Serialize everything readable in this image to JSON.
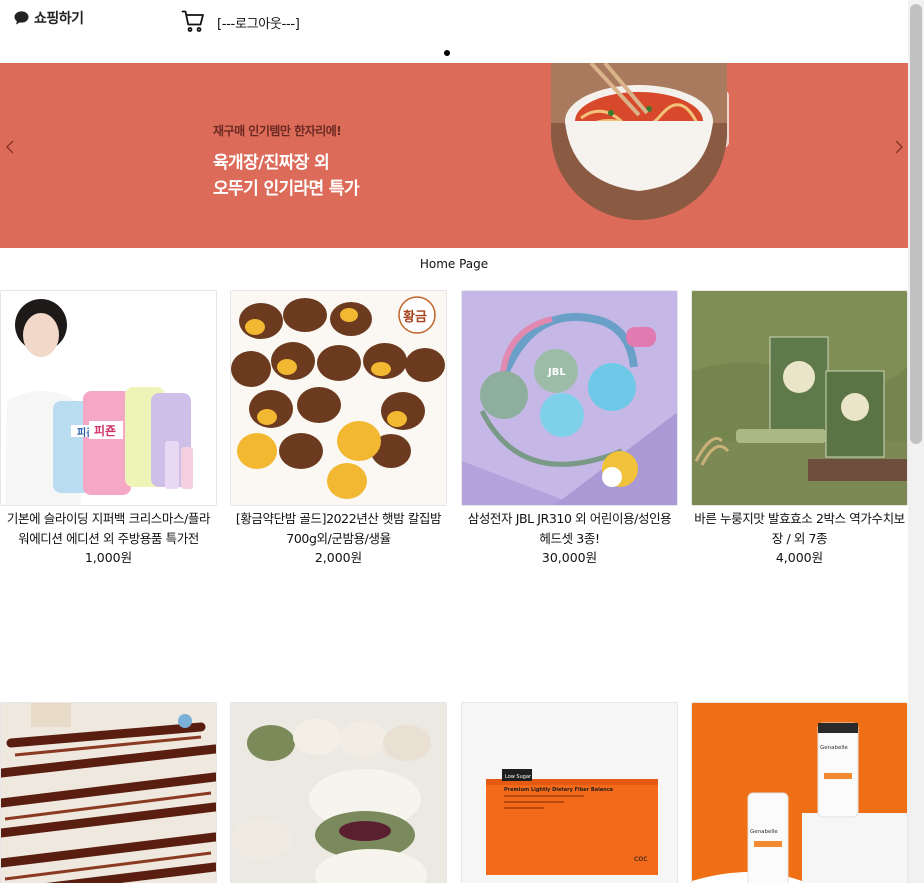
{
  "header": {
    "brand": "쇼핑하기",
    "logout": "[---로그아웃---]"
  },
  "banner": {
    "kicker": "재구매 인기템만 한자리에!",
    "line1": "육개장/진짜장 외",
    "line2": "오뚜기 인기라면 특가",
    "color": "#dd6b5a"
  },
  "home_label": "Home Page",
  "products": [
    {
      "name": "기본에 슬라이딩 지퍼백 크리스마스/플라워에디션 에디션 외 주방용품 특가전",
      "price": "1,000원"
    },
    {
      "name": "[황금약단밤 골드]2022년산 햇밤 칼집밤700g외/군밤용/생율",
      "price": "2,000원"
    },
    {
      "name": "삼성전자 JBL JR310 외 어린이용/성인용 헤드셋 3종!",
      "price": "30,000원"
    },
    {
      "name": "바른 누룽지맛 발효효소 2박스 역가수치보장 / 외 7종",
      "price": "4,000원"
    },
    {
      "name": "",
      "price": ""
    },
    {
      "name": "",
      "price": ""
    },
    {
      "name": "",
      "price": ""
    },
    {
      "name": "",
      "price": ""
    }
  ],
  "image_texts": {
    "chestnut_brand": "황금",
    "pigeon": "피죤",
    "jbl": "JBL",
    "box_tag": "Low Sugar",
    "box_text": "Premium Lightly Dietary Fiber Balance",
    "box_logo": "coc",
    "tube_brand": "Genabelle"
  },
  "icons": [
    "chat-bubble-icon",
    "cart-icon",
    "chevron-left-icon",
    "chevron-right-icon"
  ]
}
